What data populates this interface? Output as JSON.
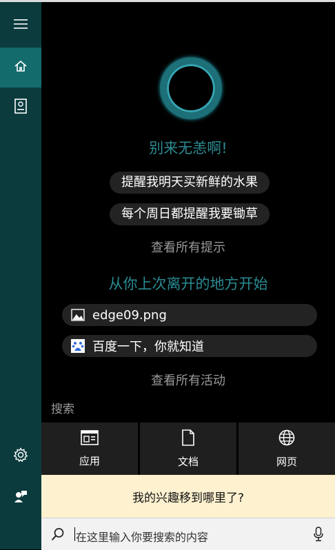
{
  "greeting": "别来无恙啊!",
  "reminders": [
    {
      "label": "提醒我明天买新鲜的水果"
    },
    {
      "label": "每个周日都提醒我要锄草"
    }
  ],
  "see_all_tips": "查看所有提示",
  "continue_title": "从你上次离开的地方开始",
  "recent_items": [
    {
      "icon": "image-icon",
      "label": "edge09.png"
    },
    {
      "icon": "baidu-icon",
      "label": "百度一下，你就知道"
    }
  ],
  "see_all_activity": "查看所有活动",
  "search_section_label": "搜索",
  "categories": [
    {
      "icon": "apps-icon",
      "label": "应用"
    },
    {
      "icon": "document-icon",
      "label": "文档"
    },
    {
      "icon": "globe-icon",
      "label": "网页"
    }
  ],
  "banner_text": "我的兴趣移到哪里了?",
  "search_placeholder": "在这里输入你要搜索的内容",
  "colors": {
    "sidebar": "#0b3b3d",
    "sidebar_active": "#146b6c",
    "accent_teal": "#2c8b93",
    "banner_bg": "#fdf1cf"
  }
}
